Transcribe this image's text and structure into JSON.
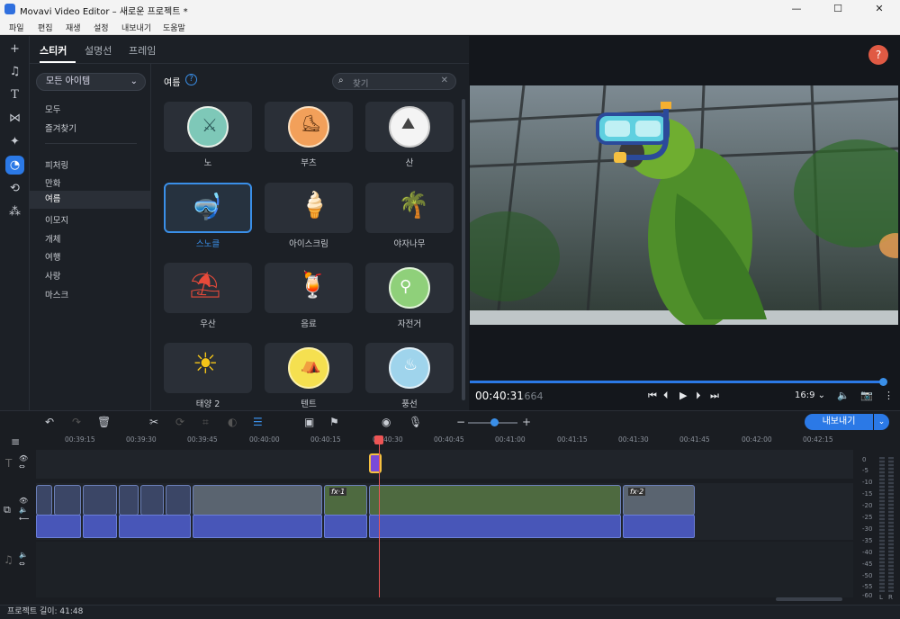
{
  "window": {
    "title": "Movavi Video Editor – 새로운 프로젝트 *",
    "minimize": "—",
    "maximize": "☐",
    "close": "✕"
  },
  "menu": [
    "파일",
    "편집",
    "재생",
    "설정",
    "내보내기",
    "도움말"
  ],
  "panel": {
    "tabs": [
      "스티커",
      "설명선",
      "프레임"
    ],
    "dropdown": "모든 아이템",
    "categories_top": [
      "모두",
      "즐겨찾기"
    ],
    "categories": [
      "피처링",
      "만화",
      "여름",
      "이모지",
      "개체",
      "여행",
      "사랑",
      "마스크"
    ],
    "selected_category": "여름",
    "section_title": "여름",
    "help": "?",
    "search_placeholder": "찾기",
    "stickers": [
      "노",
      "부츠",
      "산",
      "스노클",
      "아이스크림",
      "야자나무",
      "우산",
      "음료",
      "자전거",
      "태양 2",
      "텐트",
      "풍선"
    ],
    "selected_sticker": "스노클"
  },
  "preview": {
    "help": "?",
    "time_main": "00:40:31",
    "time_ms": ".664",
    "aspect": "16:9 ⌄"
  },
  "timeline": {
    "ticks": [
      "00:39:15",
      "00:39:30",
      "00:39:45",
      "00:40:00",
      "00:40:15",
      "00:40:30",
      "00:40:45",
      "00:41:00",
      "00:41:15",
      "00:41:30",
      "00:41:45",
      "00:42:00",
      "00:42:15"
    ],
    "fx_labels": [
      "fx·1",
      "fx·2"
    ],
    "export_label": "내보내기",
    "export_arrow": "⌄",
    "meter_labels": [
      "0",
      "-5",
      "-10",
      "-15",
      "-20",
      "-25",
      "-30",
      "-35",
      "-40",
      "-45",
      "-50",
      "-55",
      "-60"
    ],
    "meter_lr": [
      "L",
      "R"
    ]
  },
  "status": "프로젝트 길이: 41:48"
}
